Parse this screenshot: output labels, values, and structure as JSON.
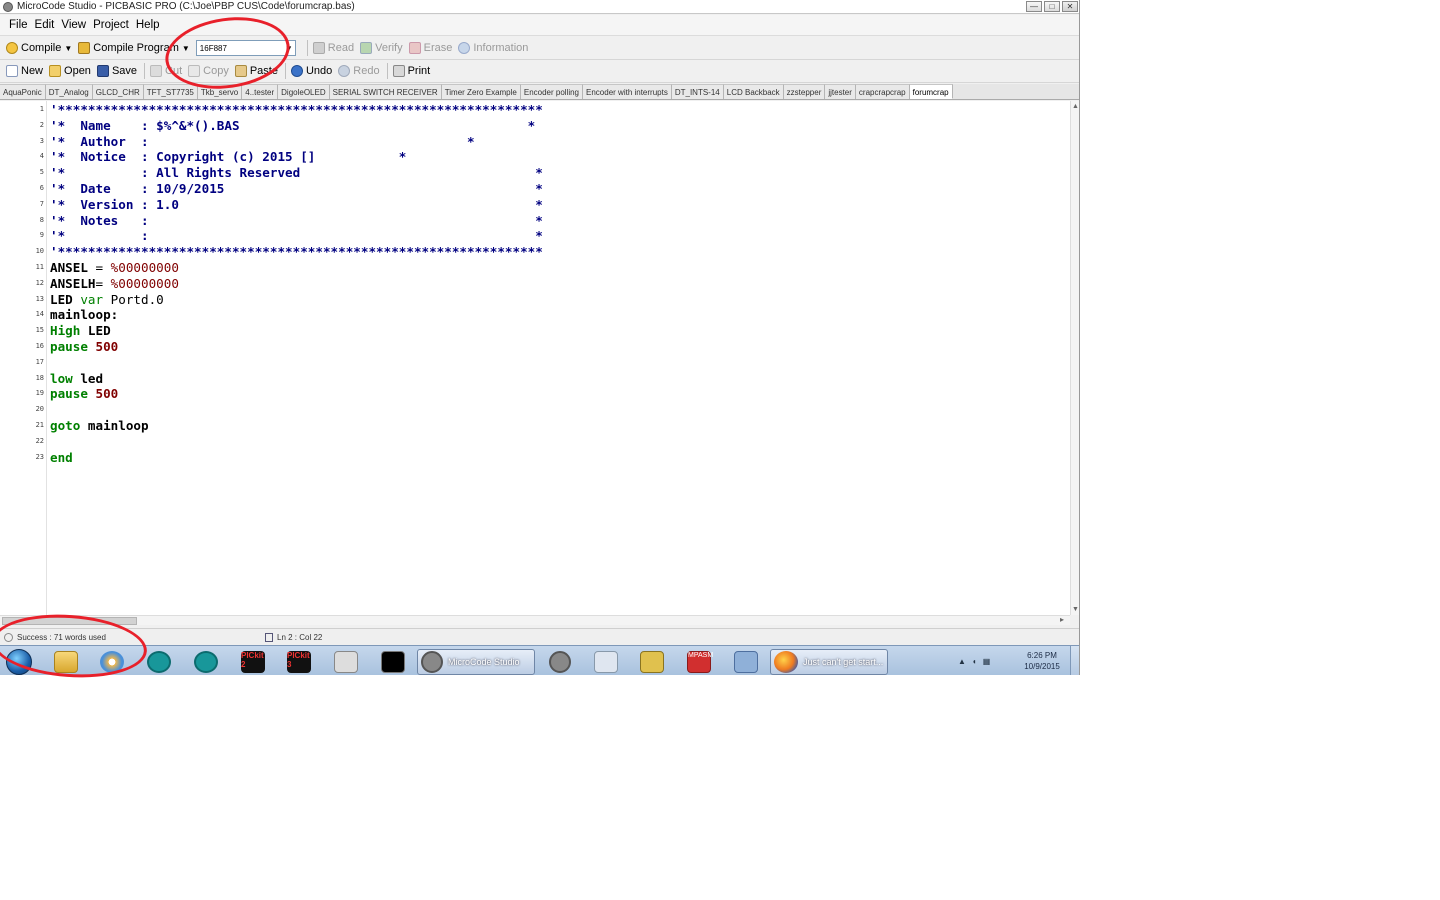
{
  "window": {
    "title": "MicroCode Studio - PICBASIC PRO (C:\\Joe\\PBP CUS\\Code\\forumcrap.bas)",
    "buttons": {
      "minimize": "—",
      "maximize": "□",
      "close": "✕"
    }
  },
  "menu": [
    "File",
    "Edit",
    "View",
    "Project",
    "Help"
  ],
  "toolbar1": {
    "compile": "Compile",
    "compile_program": "Compile Program",
    "device": "16F887",
    "read": "Read",
    "verify": "Verify",
    "erase": "Erase",
    "information": "Information"
  },
  "toolbar2": {
    "new": "New",
    "open": "Open",
    "save": "Save",
    "cut": "Cut",
    "copy": "Copy",
    "paste": "Paste",
    "undo": "Undo",
    "redo": "Redo",
    "print": "Print"
  },
  "tabs": [
    "AquaPonic",
    "DT_Analog",
    "GLCD_CHR",
    "TFT_ST7735",
    "Tkb_servo",
    "4..tester",
    "DigoleOLED",
    "SERIAL SWITCH RECEIVER",
    "Timer Zero Example",
    "Encoder polling",
    "Encoder with interrupts",
    "DT_INTS-14",
    "LCD Backback",
    "zzstepper",
    "jjtester",
    "crapcrapcrap",
    "forumcrap"
  ],
  "active_tab_index": 16,
  "code": {
    "line_numbers": [
      "1",
      "2",
      "3",
      "4",
      "5",
      "6",
      "7",
      "8",
      "9",
      "10",
      "11",
      "12",
      "13",
      "14",
      "15",
      "16",
      "17",
      "18",
      "19",
      "20",
      "21",
      "22",
      "23"
    ],
    "header": [
      "'****************************************************************",
      "'*  Name    : $%^&*().BAS                                      *",
      "'*  Author  :                                          *",
      "'*  Notice  : Copyright (c) 2015 []           *",
      "'*          : All Rights Reserved                               *",
      "'*  Date    : 10/9/2015                                         *",
      "'*  Version : 1.0                                               *",
      "'*  Notes   :                                                   *",
      "'*          :                                                   *",
      "'****************************************************************"
    ],
    "ansel_id": "ANSEL",
    "ansel_op": " = ",
    "ansel_val": "%00000000",
    "anselh_id": "ANSELH",
    "anselh_op": "= ",
    "anselh_val": "%00000000",
    "led_id": "LED ",
    "led_kw": "var",
    "led_port": " Portd.0",
    "label": "mainloop:",
    "high_kw": "High",
    "high_arg": " LED",
    "pause1_kw": "pause",
    "pause1_val": " 500",
    "low_kw": "low",
    "low_arg": " led",
    "pause2_kw": "pause",
    "pause2_val": " 500",
    "goto_kw": "goto",
    "goto_arg": " mainloop",
    "end_kw": "end"
  },
  "status": {
    "message": "Success : 71 words used",
    "position": "Ln 2 : Col 22"
  },
  "taskbar": {
    "microcode_window": "MicroCode Studio",
    "firefox_window": "Just can't get start...",
    "clock_time": "6:26 PM",
    "clock_date": "10/9/2015",
    "pickit2_label": "PICkit 2",
    "pickit3_label": "PICkit 3",
    "microchip_label": "MPASM",
    "tray_up": "▲"
  },
  "colors": {
    "comment": "#000080",
    "keyword": "#008000",
    "number": "#800000",
    "annotation": "#e8202a"
  }
}
